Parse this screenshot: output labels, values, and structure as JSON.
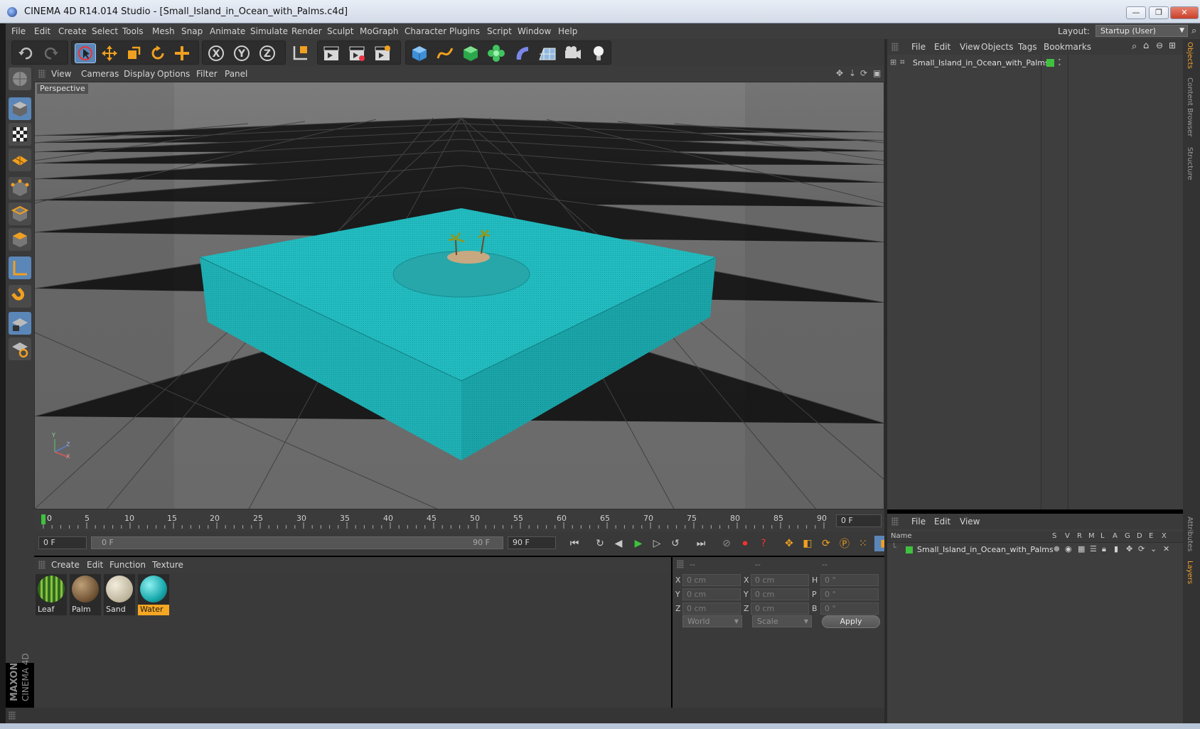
{
  "window": {
    "title": "CINEMA 4D R14.014 Studio - [Small_Island_in_Ocean_with_Palms.c4d]",
    "buttons": [
      "—",
      "❐",
      "✕"
    ]
  },
  "menubar": {
    "items": [
      "File",
      "Edit",
      "Create",
      "Select",
      "Tools",
      "Mesh",
      "Snap",
      "Animate",
      "Simulate",
      "Render",
      "Sculpt",
      "MoGraph",
      "Character",
      "Plugins",
      "Script",
      "Window",
      "Help"
    ],
    "layout_label": "Layout:",
    "layout_value": "Startup (User)"
  },
  "viewport": {
    "menu": [
      "View",
      "Cameras",
      "Display",
      "Options",
      "Filter",
      "Panel"
    ],
    "label": "Perspective",
    "axis_labels": [
      "Y",
      "Z",
      "X"
    ]
  },
  "timeline": {
    "ticks": [
      "0",
      "5",
      "10",
      "15",
      "20",
      "25",
      "30",
      "35",
      "40",
      "45",
      "50",
      "55",
      "60",
      "65",
      "70",
      "75",
      "80",
      "85",
      "90"
    ],
    "current_frame_display": "0 F"
  },
  "transport": {
    "start_field": "0 F",
    "range_start": "0 F",
    "range_end": "90 F",
    "end_field": "90 F"
  },
  "materials": {
    "menu": [
      "Create",
      "Edit",
      "Function",
      "Texture"
    ],
    "items": [
      {
        "name": "Leaf"
      },
      {
        "name": "Palm"
      },
      {
        "name": "Sand"
      },
      {
        "name": "Water",
        "selected": true
      }
    ]
  },
  "coordinates": {
    "headers": [
      "--",
      "--",
      "--"
    ],
    "rows": [
      {
        "l1": "X",
        "v1": "0 cm",
        "l2": "X",
        "v2": "0 cm",
        "l3": "H",
        "v3": "0 °"
      },
      {
        "l1": "Y",
        "v1": "0 cm",
        "l2": "Y",
        "v2": "0 cm",
        "l3": "P",
        "v3": "0 °"
      },
      {
        "l1": "Z",
        "v1": "0 cm",
        "l2": "Z",
        "v2": "0 cm",
        "l3": "B",
        "v3": "0 °"
      }
    ],
    "space": "World",
    "mode": "Scale",
    "apply": "Apply"
  },
  "object_manager": {
    "menu": [
      "File",
      "Edit",
      "View",
      "Objects",
      "Tags",
      "Bookmarks"
    ],
    "object_name": "Small_Island_in_Ocean_with_Palms"
  },
  "layer_manager": {
    "menu": [
      "File",
      "Edit",
      "View"
    ],
    "columns": [
      "Name",
      "S",
      "V",
      "R",
      "M",
      "L",
      "A",
      "G",
      "D",
      "E",
      "X"
    ],
    "layer_name": "Small_Island_in_Ocean_with_Palms"
  },
  "right_tabs": [
    "Objects",
    "Content Browser",
    "Structure",
    "Attributes",
    "Layers"
  ],
  "colors": {
    "water": "#1fb0b4",
    "accent_blue": "#5a86b8",
    "selected_material": "#f5a623",
    "layer_green": "#3ec23e"
  },
  "branding": {
    "maxon": "MAXON",
    "product": "CINEMA 4D"
  }
}
